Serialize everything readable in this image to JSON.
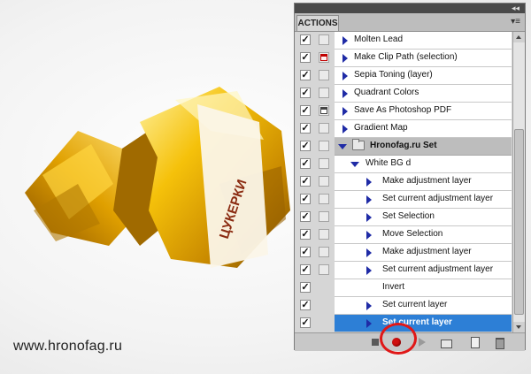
{
  "watermark": "www.hronofag.ru",
  "candy_label": "ЦУКЕРКИ",
  "panel": {
    "title": "ACTIONS",
    "collapse_glyph": "◂◂",
    "menu_glyph": "▾≡"
  },
  "rows": [
    {
      "label": "Molten Lead",
      "checked": true,
      "dialog": "none",
      "kind": "action"
    },
    {
      "label": "Make Clip Path (selection)",
      "checked": true,
      "dialog": "red",
      "kind": "action"
    },
    {
      "label": "Sepia Toning (layer)",
      "checked": true,
      "dialog": "none",
      "kind": "action"
    },
    {
      "label": "Quadrant Colors",
      "checked": true,
      "dialog": "none",
      "kind": "action"
    },
    {
      "label": "Save As Photoshop PDF",
      "checked": true,
      "dialog": "dark",
      "kind": "action"
    },
    {
      "label": "Gradient Map",
      "checked": true,
      "dialog": "none",
      "kind": "action"
    },
    {
      "label": "Hronofag.ru Set",
      "checked": true,
      "dialog": "none",
      "kind": "set"
    },
    {
      "label": "White BG d",
      "checked": true,
      "dialog": "none",
      "kind": "action-open"
    },
    {
      "label": "Make adjustment layer",
      "checked": true,
      "dialog": "none",
      "kind": "step"
    },
    {
      "label": "Set current adjustment layer",
      "checked": true,
      "dialog": "none",
      "kind": "step"
    },
    {
      "label": "Set Selection",
      "checked": true,
      "dialog": "none",
      "kind": "step"
    },
    {
      "label": "Move Selection",
      "checked": true,
      "dialog": "none",
      "kind": "step"
    },
    {
      "label": "Make adjustment layer",
      "checked": true,
      "dialog": "box",
      "kind": "step"
    },
    {
      "label": "Set current adjustment layer",
      "checked": true,
      "dialog": "box",
      "kind": "step"
    },
    {
      "label": "Invert",
      "checked": true,
      "dialog": "none",
      "kind": "step-noarrow"
    },
    {
      "label": "Set current layer",
      "checked": true,
      "dialog": "none",
      "kind": "step"
    },
    {
      "label": "Set current layer",
      "checked": true,
      "dialog": "none",
      "kind": "step-selected"
    }
  ],
  "footer": {
    "buttons": [
      "stop-icon",
      "record-icon",
      "play-icon",
      "new-set-icon",
      "new-action-icon",
      "delete-icon"
    ]
  }
}
